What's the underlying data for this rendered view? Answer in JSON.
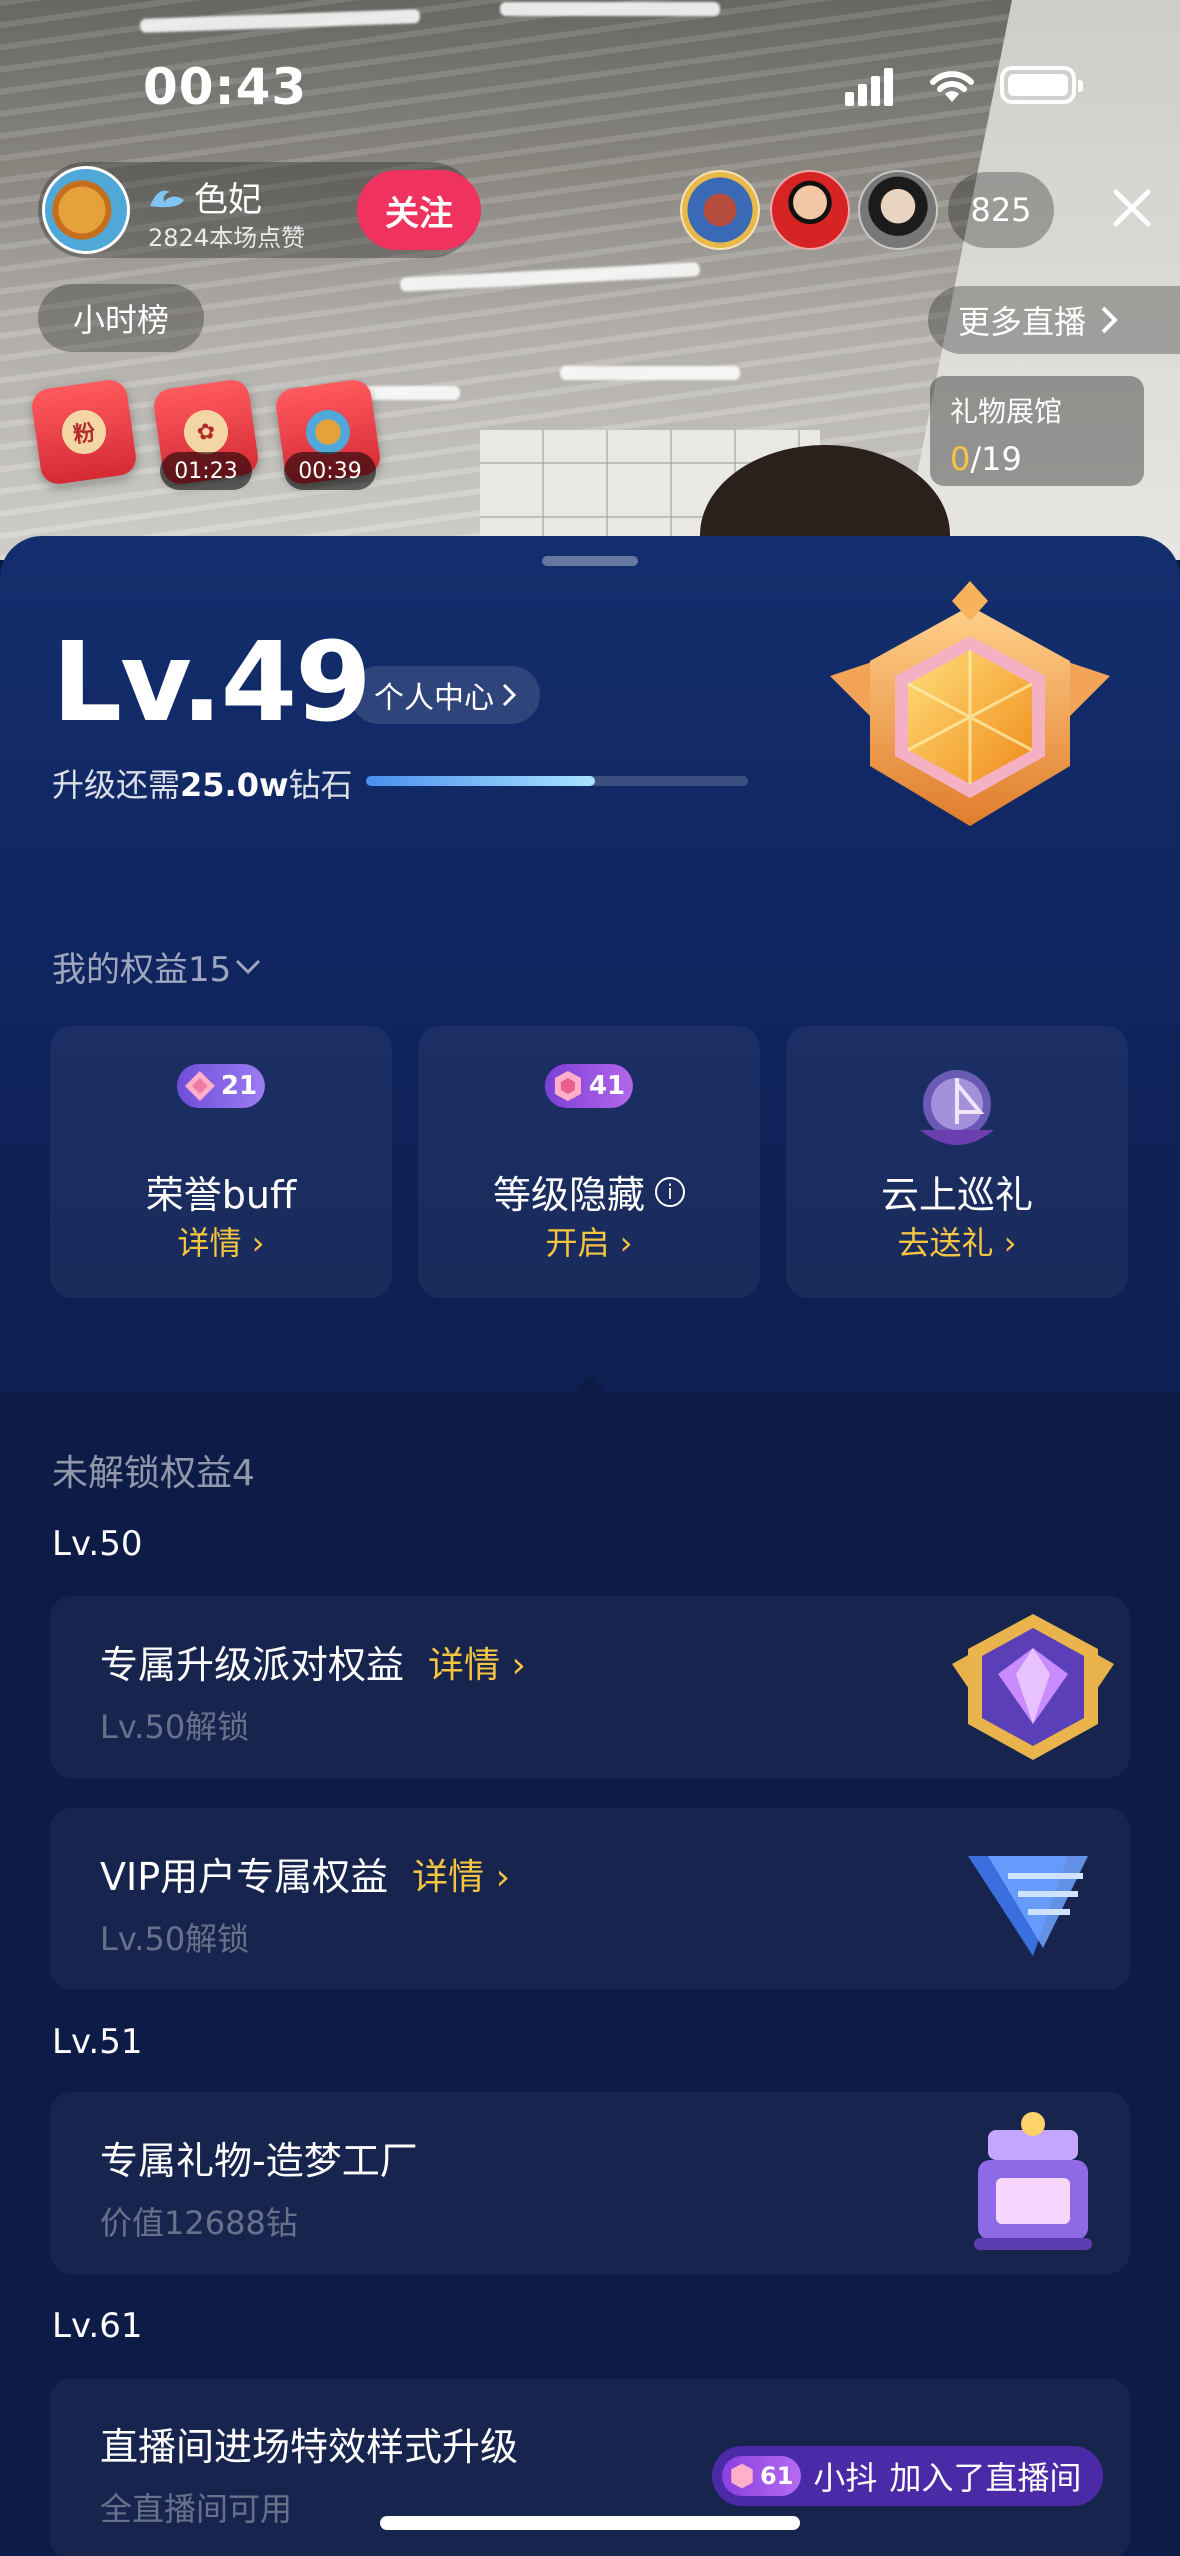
{
  "status_bar": {
    "time": "00:43"
  },
  "host": {
    "name": "色妃",
    "likes": "2824本场点赞",
    "follow_label": "关注"
  },
  "viewers": {
    "count": "825"
  },
  "top": {
    "hourly_rank": "小时榜",
    "more_live": "更多直播"
  },
  "red_packets": [
    {
      "seal": "粉",
      "timer": ""
    },
    {
      "seal": "",
      "timer": "01:23"
    },
    {
      "seal": "",
      "timer": "00:39"
    }
  ],
  "gift_hall": {
    "title": "礼物展馆",
    "current": "0",
    "total": "/19"
  },
  "level": {
    "title": "Lv.49",
    "personal_center": "个人中心",
    "upgrade_prefix": "升级还需",
    "upgrade_amount": "25.0w",
    "upgrade_suffix": "钻石",
    "progress": 0.6
  },
  "my_rights": {
    "header": "我的权益15",
    "items": [
      {
        "badge": "21",
        "title": "荣誉buff",
        "link": "详情"
      },
      {
        "badge": "41",
        "title": "等级隐藏",
        "link": "开启"
      },
      {
        "badge": "",
        "title": "云上巡礼",
        "link": "去送礼"
      }
    ]
  },
  "locked": {
    "header": "未解锁权益4",
    "groups": [
      {
        "level": "Lv.50",
        "items": [
          {
            "title": "专属升级派对权益",
            "detail": "详情",
            "sub": "Lv.50解锁"
          },
          {
            "title": "VIP用户专属权益",
            "detail": "详情",
            "sub": "Lv.50解锁"
          }
        ]
      },
      {
        "level": "Lv.51",
        "items": [
          {
            "title": "专属礼物-造梦工厂",
            "detail": "",
            "sub": "价值12688钻"
          }
        ]
      },
      {
        "level": "Lv.61",
        "items": [
          {
            "title": "直播间进场特效样式升级",
            "detail": "",
            "sub": "全直播间可用"
          }
        ]
      }
    ]
  },
  "toast": {
    "badge": "61",
    "user": "小抖",
    "message": "加入了直播间"
  },
  "colors": {
    "accent_gold": "#f5c542",
    "follow_pink": "#f0335e",
    "sheet_blue": "#102661"
  }
}
